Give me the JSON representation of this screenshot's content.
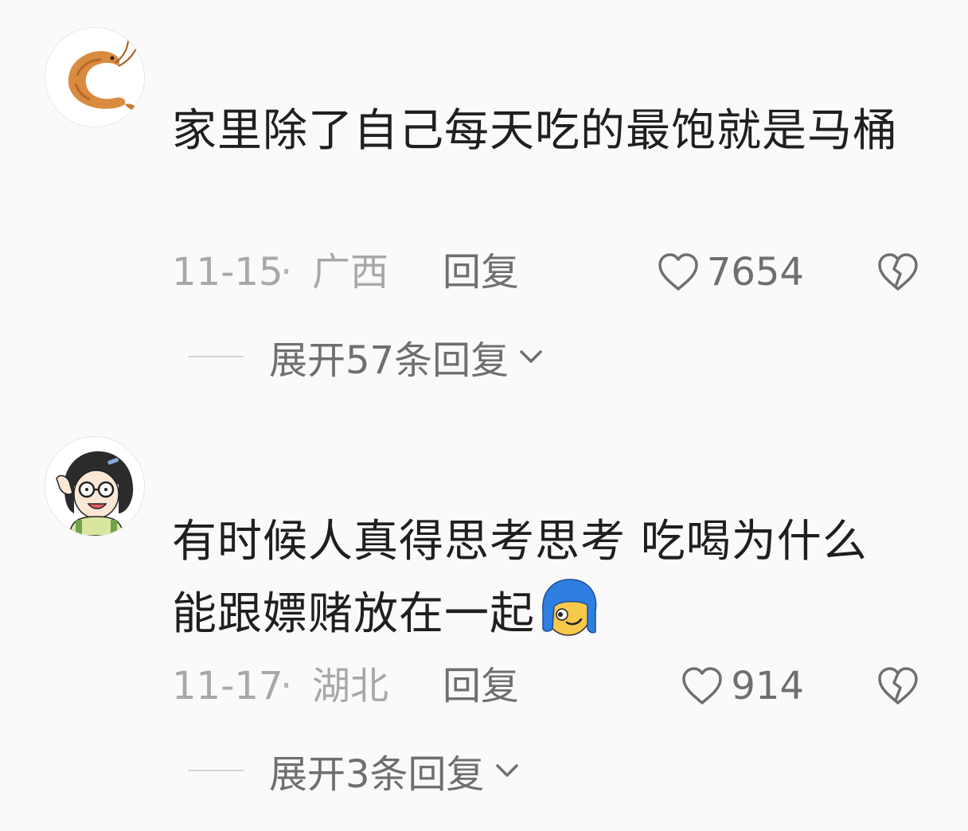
{
  "comments": [
    {
      "avatar_icon": "shrimp-avatar",
      "text": "家里除了自己每天吃的最饱就是马桶",
      "date": "11-15",
      "separator": "·",
      "location": "广西",
      "reply_label": "回复",
      "like_icon": "heart-outline-icon",
      "likes": "7654",
      "dislike_icon": "broken-heart-icon",
      "expand_label": "展开57条回复",
      "expand_icon": "chevron-down-icon"
    },
    {
      "avatar_icon": "girl-with-glasses-avatar",
      "text": "有时候人真得思考思考 吃喝为什么能跟嫖赌放在一起",
      "emoji": "blue-hair-smirk-emoji",
      "date": "11-17",
      "separator": "·",
      "location": "湖北",
      "reply_label": "回复",
      "like_icon": "heart-outline-icon",
      "likes": "914",
      "dislike_icon": "broken-heart-icon",
      "expand_label": "展开3条回复",
      "expand_icon": "chevron-down-icon"
    }
  ],
  "colors": {
    "background": "#fafafa",
    "text": "#1f1f1f",
    "meta": "#a8a8a8",
    "action": "#6f6f6f"
  }
}
